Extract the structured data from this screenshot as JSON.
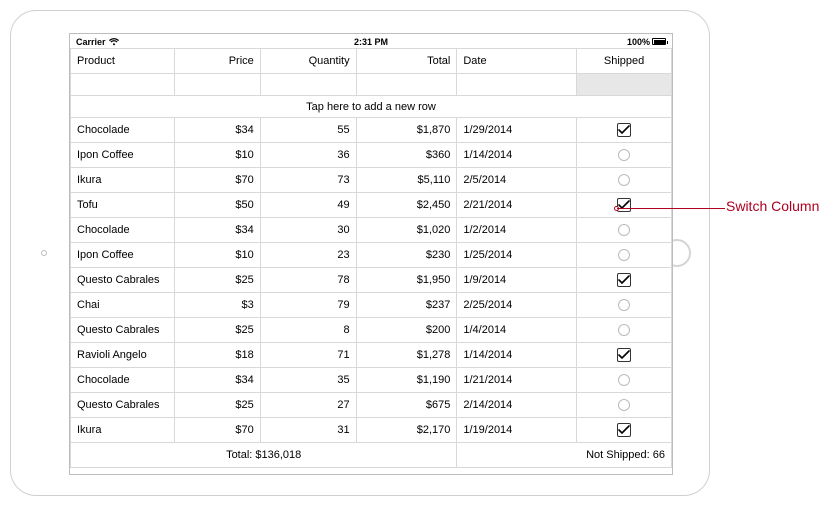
{
  "status_bar": {
    "carrier": "Carrier",
    "time": "2:31 PM",
    "battery": "100%"
  },
  "columns": {
    "product": "Product",
    "price": "Price",
    "quantity": "Quantity",
    "total": "Total",
    "date": "Date",
    "shipped": "Shipped"
  },
  "add_row_text": "Tap here to add a new row",
  "rows": [
    {
      "product": "Chocolade",
      "price": "$34",
      "quantity": "55",
      "total": "$1,870",
      "date": "1/29/2014",
      "shipped": true
    },
    {
      "product": "Ipon Coffee",
      "price": "$10",
      "quantity": "36",
      "total": "$360",
      "date": "1/14/2014",
      "shipped": false
    },
    {
      "product": "Ikura",
      "price": "$70",
      "quantity": "73",
      "total": "$5,110",
      "date": "2/5/2014",
      "shipped": false
    },
    {
      "product": "Tofu",
      "price": "$50",
      "quantity": "49",
      "total": "$2,450",
      "date": "2/21/2014",
      "shipped": true
    },
    {
      "product": "Chocolade",
      "price": "$34",
      "quantity": "30",
      "total": "$1,020",
      "date": "1/2/2014",
      "shipped": false
    },
    {
      "product": "Ipon Coffee",
      "price": "$10",
      "quantity": "23",
      "total": "$230",
      "date": "1/25/2014",
      "shipped": false
    },
    {
      "product": "Questo Cabrales",
      "price": "$25",
      "quantity": "78",
      "total": "$1,950",
      "date": "1/9/2014",
      "shipped": true
    },
    {
      "product": "Chai",
      "price": "$3",
      "quantity": "79",
      "total": "$237",
      "date": "2/25/2014",
      "shipped": false
    },
    {
      "product": "Questo Cabrales",
      "price": "$25",
      "quantity": "8",
      "total": "$200",
      "date": "1/4/2014",
      "shipped": false
    },
    {
      "product": "Ravioli Angelo",
      "price": "$18",
      "quantity": "71",
      "total": "$1,278",
      "date": "1/14/2014",
      "shipped": true
    },
    {
      "product": "Chocolade",
      "price": "$34",
      "quantity": "35",
      "total": "$1,190",
      "date": "1/21/2014",
      "shipped": false
    },
    {
      "product": "Questo Cabrales",
      "price": "$25",
      "quantity": "27",
      "total": "$675",
      "date": "2/14/2014",
      "shipped": false
    },
    {
      "product": "Ikura",
      "price": "$70",
      "quantity": "31",
      "total": "$2,170",
      "date": "1/19/2014",
      "shipped": true
    }
  ],
  "footer": {
    "total_label": "Total: $136,018",
    "not_shipped_label": "Not Shipped: 66"
  },
  "callout": {
    "label": "Switch Column"
  }
}
